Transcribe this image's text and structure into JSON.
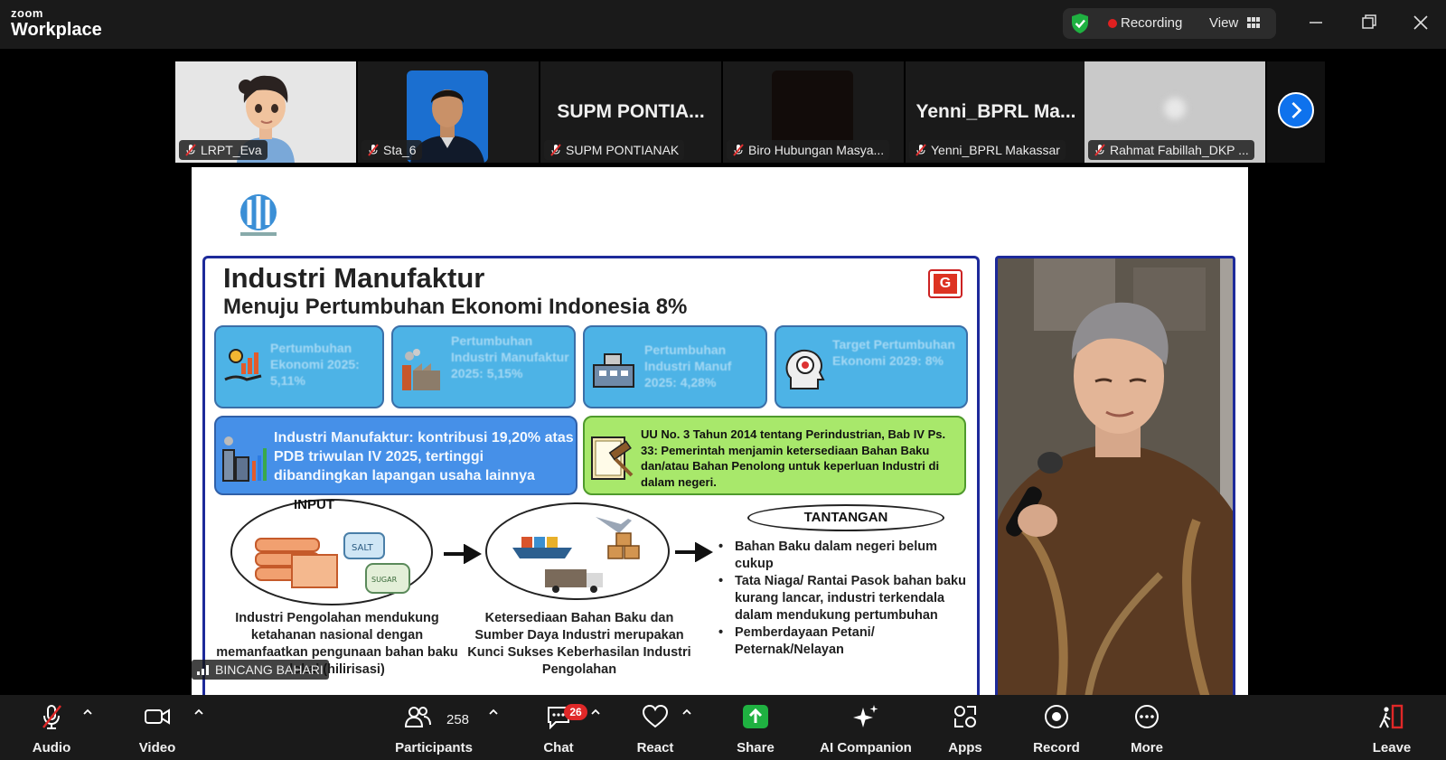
{
  "app": {
    "logo_line1": "zoom",
    "logo_line2": "Workplace"
  },
  "topbar": {
    "recording_label": "Recording",
    "view_label": "View",
    "colors": {
      "shield": "#1fb141",
      "recording_dot": "#e02020"
    }
  },
  "participants": [
    {
      "name": "LRPT_Eva",
      "video": "avatar"
    },
    {
      "name": "Sta_6",
      "video": "photo"
    },
    {
      "name": "SUPM PONTIANAK",
      "video": "off",
      "display": "SUPM  PONTIA..."
    },
    {
      "name": "Biro Hubungan Masya...",
      "video": "dark"
    },
    {
      "name": "Yenni_BPRL Makassar",
      "video": "off",
      "display": "Yenni_BPRL  Ma..."
    },
    {
      "name": "Rahmat Fabillah_DKP ...",
      "video": "blurred"
    }
  ],
  "shared_screen": {
    "presenter_name": "BINCANG BAHARI",
    "slide": {
      "title": "Industri Manufaktur",
      "subtitle": "Menuju Pertumbuhan Ekonomi Indonesia 8%",
      "top_cards": [
        {
          "text": "Pertumbuhan Ekonomi 2025: 5,11%",
          "icon": "economy-growth-icon"
        },
        {
          "text": "Pertumbuhan Industri Manufaktur 2025: 5,15%",
          "icon": "factory-icon"
        },
        {
          "text": "Pertumbuhan Industri Manuf 2025: 4,28%",
          "icon": "industry-machine-icon"
        },
        {
          "text": "Target Pertumbuhan Ekonomi 2029: 8%",
          "icon": "target-head-icon"
        }
      ],
      "contribution_text": "Industri Manufaktur: kontribusi 19,20% atas PDB triwulan IV 2025, tertinggi dibandingkan lapangan usaha lainnya",
      "law_text": "UU No. 3 Tahun 2014 tentang Perindustrian, Bab IV Ps. 33: Pemerintah menjamin ketersediaan Bahan Baku dan/atau Bahan Penolong untuk keperluan Industri di dalam negeri.",
      "input_label": "INPUT",
      "input_caption": "Industri Pengolahan mendukung ketahanan nasional dengan memanfaatkan pengunaan bahan baku lokal (hilirisasi)",
      "supply_caption": "Ketersediaan Bahan Baku dan Sumber Daya Industri merupakan Kunci Sukses Keberhasilan Industri Pengolahan",
      "challenges_title": "TANTANGAN",
      "challenges": [
        "Bahan Baku dalam negeri belum cukup",
        "Tata Niaga/ Rantai Pasok bahan baku kurang lancar, industri terkendala dalam mendukung pertumbuhan",
        "Pemberdayaan Petani/ Peternak/Nelayan"
      ],
      "colors": {
        "border": "#1d2a9a",
        "card_blue": "#4db3e6",
        "card_dark_blue": "#4690e8",
        "card_green": "#a8e86b"
      }
    }
  },
  "toolbar": {
    "audio": "Audio",
    "video": "Video",
    "participants": "Participants",
    "participants_count": "258",
    "chat": "Chat",
    "chat_badge": "26",
    "react": "React",
    "share": "Share",
    "ai_companion": "AI Companion",
    "apps": "Apps",
    "record": "Record",
    "more": "More",
    "leave": "Leave",
    "colors": {
      "share": "#1fb141",
      "leave": "#e02828"
    }
  }
}
